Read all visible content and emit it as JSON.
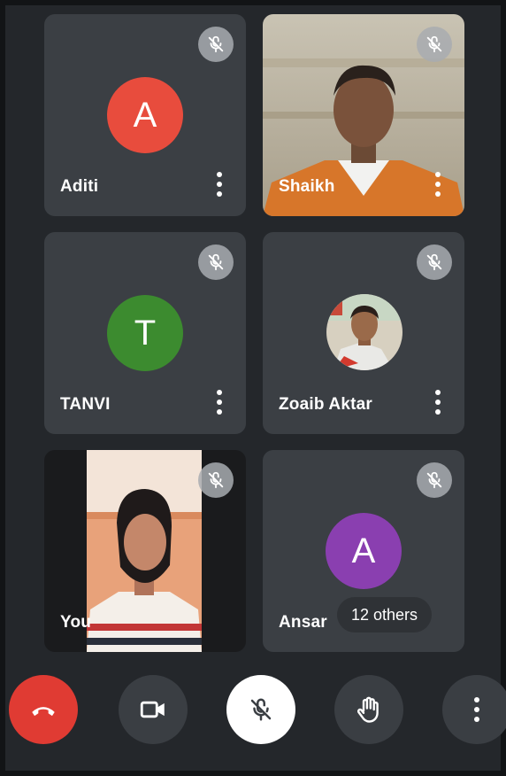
{
  "participants": [
    {
      "name": "Aditi",
      "initial": "A",
      "avatar_color": "#e84c3d",
      "muted": true
    },
    {
      "name": "Shaikh",
      "muted": true
    },
    {
      "name": "TANVI",
      "initial": "T",
      "avatar_color": "#3c8b2f",
      "muted": true
    },
    {
      "name": "Zoaib Aktar",
      "muted": true
    },
    {
      "name": "You",
      "muted": true
    },
    {
      "name": "Ansar",
      "initial": "A",
      "avatar_color": "#8a3fb0",
      "muted": true
    }
  ],
  "others_chip": "12 others",
  "controls": {
    "end_call": "end-call",
    "camera": "camera",
    "microphone": "microphone-muted",
    "raise_hand": "raise-hand",
    "more": "more-options"
  }
}
